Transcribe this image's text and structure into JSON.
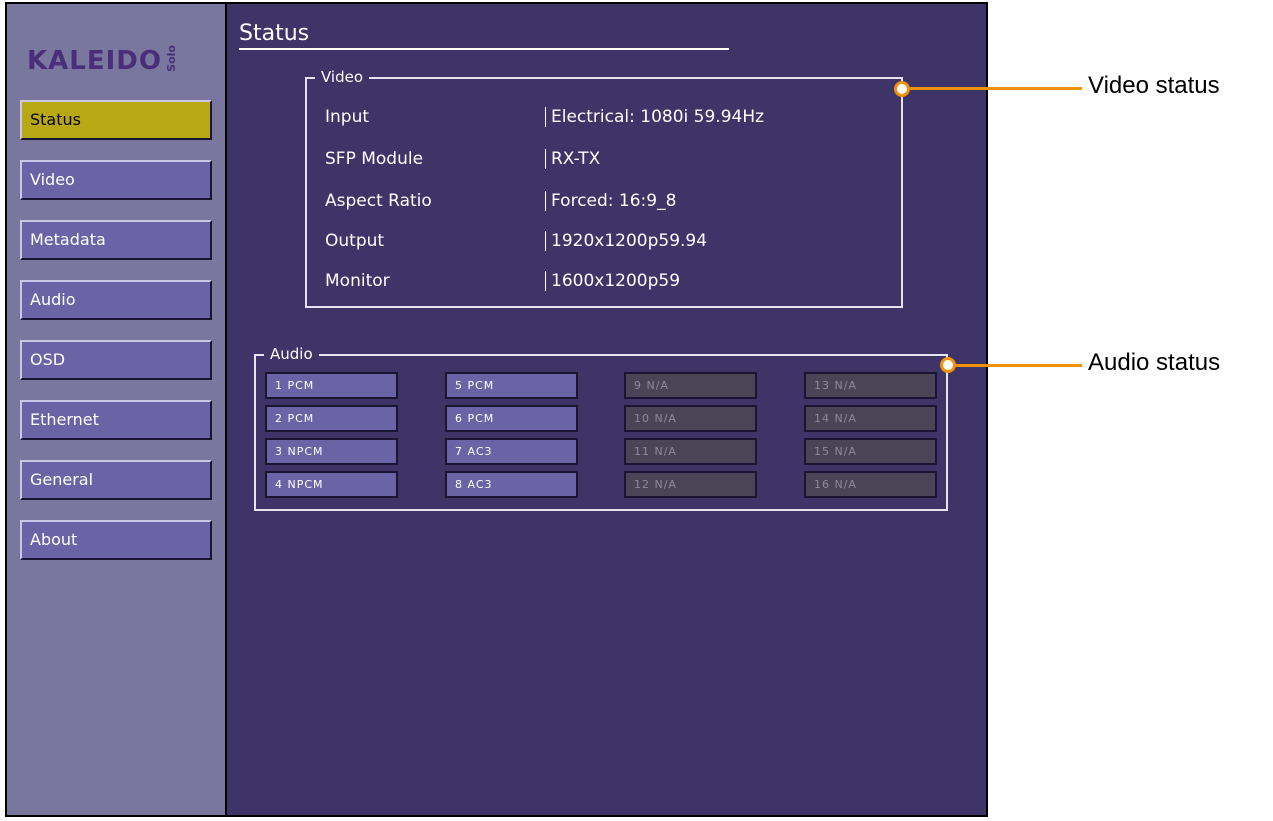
{
  "logo": {
    "main": "KALEIDO",
    "sub": "Solo"
  },
  "nav": [
    {
      "label": "Status",
      "active": true
    },
    {
      "label": "Video",
      "active": false
    },
    {
      "label": "Metadata",
      "active": false
    },
    {
      "label": "Audio",
      "active": false
    },
    {
      "label": "OSD",
      "active": false
    },
    {
      "label": "Ethernet",
      "active": false
    },
    {
      "label": "General",
      "active": false
    },
    {
      "label": "About",
      "active": false
    }
  ],
  "page_title": "Status",
  "video": {
    "legend": "Video",
    "rows": [
      {
        "label": "Input",
        "value": "Electrical: 1080i 59.94Hz"
      },
      {
        "label": "SFP Module",
        "value": "RX-TX"
      },
      {
        "label": "Aspect Ratio",
        "value": "Forced: 16:9_8"
      },
      {
        "label": "Output",
        "value": "1920x1200p59.94"
      },
      {
        "label": "Monitor",
        "value": "1600x1200p59"
      }
    ]
  },
  "audio": {
    "legend": "Audio",
    "channels": [
      {
        "label": "1 PCM",
        "available": true
      },
      {
        "label": "2 PCM",
        "available": true
      },
      {
        "label": "3 NPCM",
        "available": true
      },
      {
        "label": "4 NPCM",
        "available": true
      },
      {
        "label": "5 PCM",
        "available": true
      },
      {
        "label": "6 PCM",
        "available": true
      },
      {
        "label": "7 AC3",
        "available": true
      },
      {
        "label": "8 AC3",
        "available": true
      },
      {
        "label": "9 N/A",
        "available": false
      },
      {
        "label": "10 N/A",
        "available": false
      },
      {
        "label": "11 N/A",
        "available": false
      },
      {
        "label": "12 N/A",
        "available": false
      },
      {
        "label": "13 N/A",
        "available": false
      },
      {
        "label": "14 N/A",
        "available": false
      },
      {
        "label": "15 N/A",
        "available": false
      },
      {
        "label": "16 N/A",
        "available": false
      }
    ]
  },
  "callouts": {
    "video": "Video status",
    "audio": "Audio status"
  },
  "colors": {
    "panel": "#3e3468",
    "sidebar": "#7a779e",
    "button": "#6a64a6",
    "active_button": "#b8a814",
    "na_chip": "#4a4457",
    "callout": "#f0920c"
  }
}
